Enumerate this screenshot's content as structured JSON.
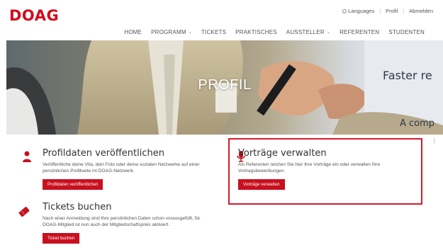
{
  "brand": {
    "logo_text": "DOAG",
    "accent": "#c8101e"
  },
  "util_nav": {
    "languages": "Languages",
    "profile": "Profil",
    "logout": "Abmelden"
  },
  "main_nav": [
    {
      "label": "HOME"
    },
    {
      "label": "PROGRAMM",
      "dropdown": true
    },
    {
      "label": "TICKETS"
    },
    {
      "label": "PRAKTISCHES"
    },
    {
      "label": "AUSSTELLER",
      "dropdown": true
    },
    {
      "label": "REFERENTEN"
    },
    {
      "label": "STUDENTEN"
    }
  ],
  "hero": {
    "title": "PROFIL",
    "bg_text_1": "Faster re",
    "bg_text_2": "A comp"
  },
  "cards": {
    "profile": {
      "title": "Profildaten veröffentlichen",
      "text": "Veröffentliche deine Vita, dein Foto oder deine sozialen Netzwerke auf einer persönlichen Profilseite im DOAG-Netzwerk.",
      "button": "Profildaten veröffentlichen",
      "icon": "user-icon"
    },
    "talks": {
      "title": "Vorträge verwalten",
      "text": "Als Referenten reichen Sie hier Ihre Vorträge ein oder verwalten Ihre Vortragsbewerbungen.",
      "button": "Vorträge verwalten",
      "icon": "microphone-icon"
    },
    "tickets": {
      "title": "Tickets buchen",
      "text": "Nach einer Anmeldung sind Ihre persönlichen Daten schon vorausgefüllt, für DOAG-Mitglied ist nun auch der Mitgliedschaftspreis aktiviert.",
      "button": "Ticket buchen",
      "icon": "ticket-icon"
    }
  }
}
